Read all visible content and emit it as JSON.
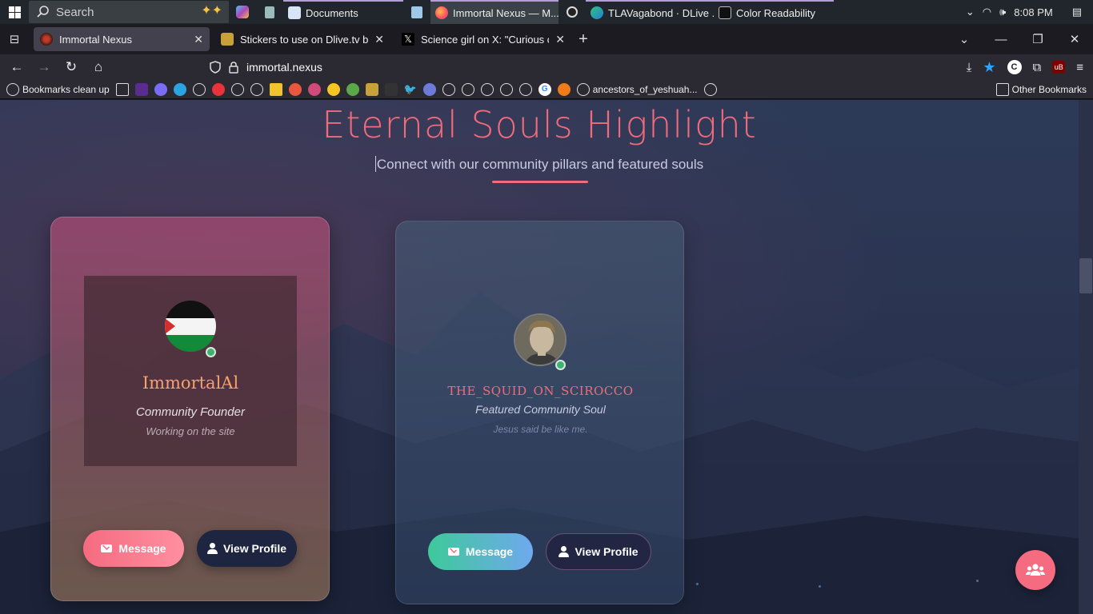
{
  "taskbar": {
    "search_placeholder": "Search",
    "apps": [
      {
        "label": "Documents"
      },
      {
        "label": "Immortal Nexus — M..."
      },
      {
        "label": "TLAVagabond · DLive ..."
      },
      {
        "label": "Color Readability"
      }
    ],
    "time": "8:08 PM"
  },
  "tabs": [
    {
      "title": "Immortal Nexus",
      "active": true
    },
    {
      "title": "Stickers to use on Dlive.tv by sp"
    },
    {
      "title": "Science girl on X: \"Curious coug"
    }
  ],
  "navbar": {
    "url": "immortal.nexus"
  },
  "bookmarks": {
    "first": "Bookmarks clean up",
    "named": "ancestors_of_yeshuah...",
    "other": "Other Bookmarks"
  },
  "section": {
    "title": "Eternal Souls Highlight",
    "subtitle": "Connect with our community pillars and featured souls"
  },
  "cards": [
    {
      "name": "ImmortalAl",
      "role": "Community Founder",
      "status": "Working on the site",
      "message_label": "Message",
      "profile_label": "View Profile"
    },
    {
      "name": "THE_SQUID_ON_SCIROCCO",
      "role": "Featured Community Soul",
      "status": "Jesus said be like me.",
      "message_label": "Message",
      "profile_label": "View Profile"
    }
  ],
  "colors": {
    "accent": "#f06b7c",
    "founder_name": "#f5a36b",
    "online": "#3cb371"
  }
}
